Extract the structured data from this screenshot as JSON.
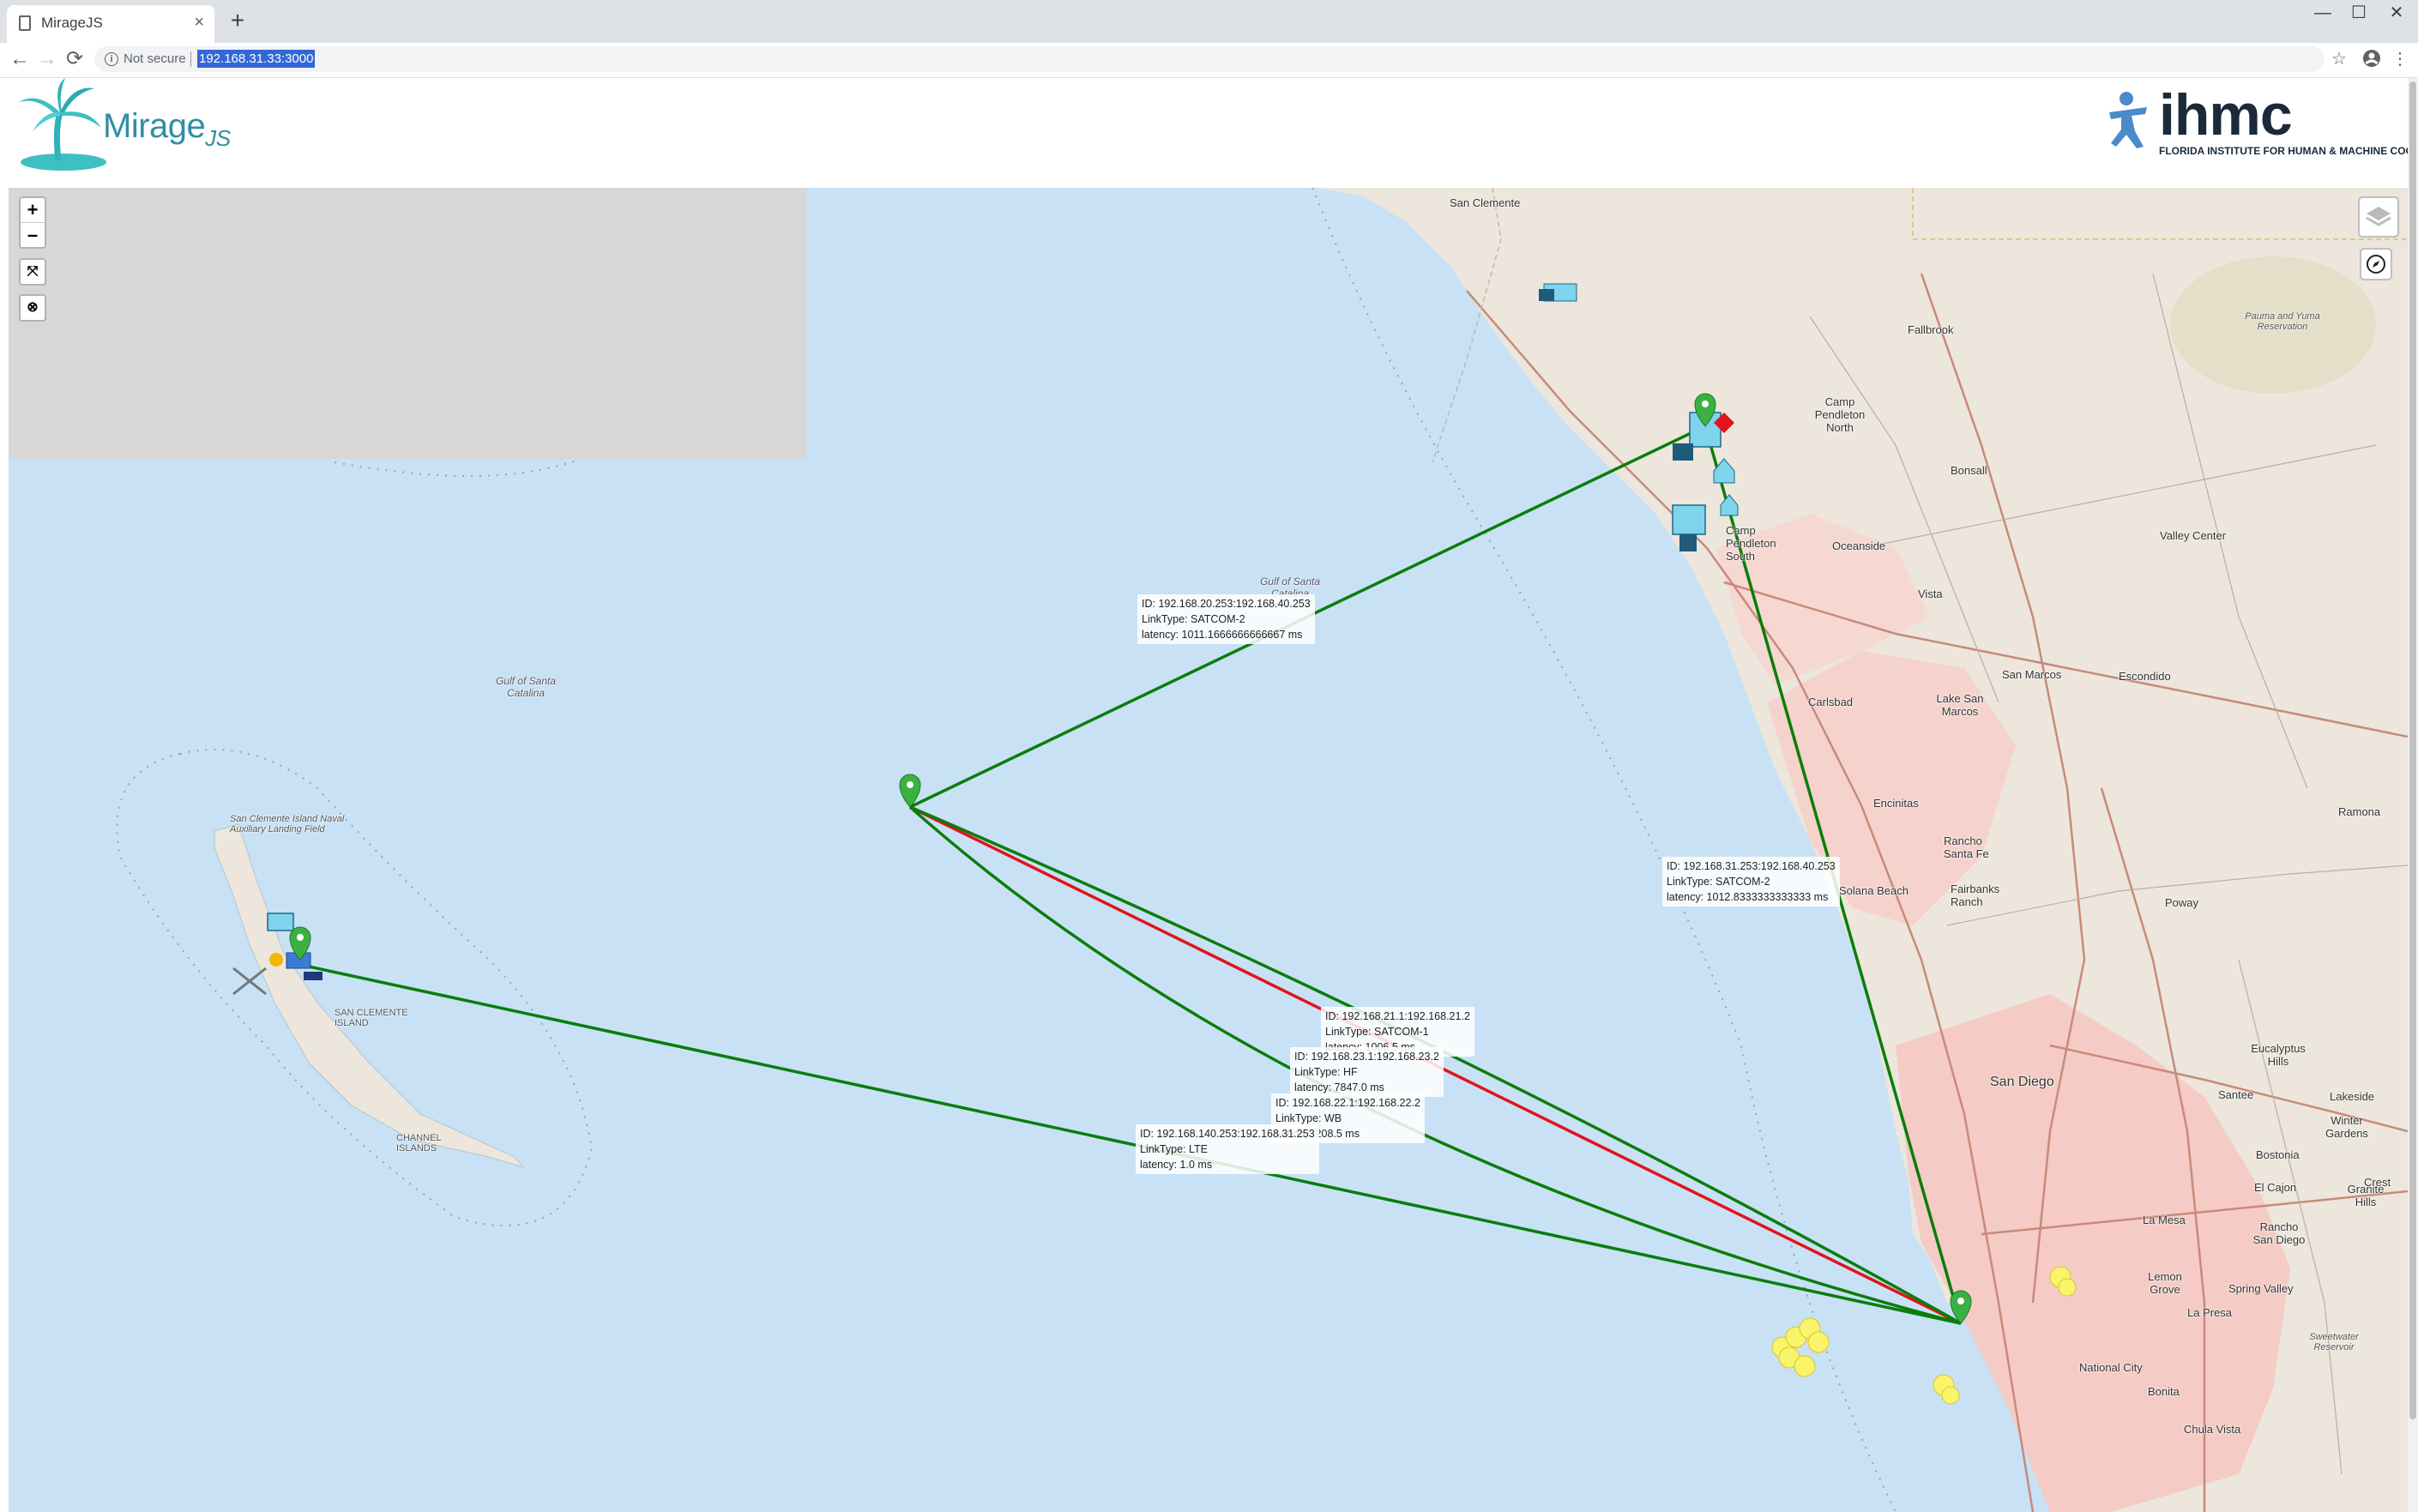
{
  "browser": {
    "tab_title": "MirageJS",
    "tab_close": "×",
    "new_tab": "+",
    "security_label": "Not secure",
    "url": "192.168.31.33:3000",
    "window_controls": {
      "minimize": "—",
      "maximize": "☐",
      "close": "✕"
    },
    "nav": {
      "back": "←",
      "forward": "→",
      "reload": "⟳"
    }
  },
  "header": {
    "app_name": "Mirage",
    "app_suffix": "JS",
    "org_name": "ihmc",
    "org_full": "FLORIDA INSTITUTE FOR HUMAN & MACHINE COGNITION"
  },
  "map_controls": {
    "zoom_in": "+",
    "zoom_out": "–",
    "fit": "⤧",
    "clear": "⊗"
  },
  "colors": {
    "link_good": "#0a7d0a",
    "link_bad": "#e0141a",
    "marker": "#3bb143",
    "water": "#c8e1f5",
    "land": "#ede7df",
    "urban": "#f4c7c3"
  },
  "places": [
    "San Clemente",
    "Fallbrook",
    "Camp Pendleton North",
    "Bonsall",
    "Valley Center",
    "Oceanside",
    "Camp Pendleton South",
    "Vista",
    "San Marcos",
    "Escondido",
    "Carlsbad",
    "Lake San Marcos",
    "Encinitas",
    "Rancho Santa Fe",
    "Solana Beach",
    "Fairbanks Ranch",
    "Poway",
    "Ramona",
    "San Diego",
    "Santee",
    "Lakeside",
    "Eucalyptus Hills",
    "Winter Gardens",
    "Bostonia",
    "El Cajon",
    "Granite Hills",
    "La Mesa",
    "Lemon Grove",
    "Rancho San Diego",
    "Spring Valley",
    "La Presa",
    "National City",
    "Bonita",
    "Chula Vista",
    "Crest",
    "Gulf of Santa Catalina",
    "Gulf of Santa Catalina",
    "San Clemente Island Naval Auxiliary Landing Field",
    "SAN CLEMENTE ISLAND",
    "CHANNEL ISLANDS",
    "Pauma and Yuma Reservation",
    "Sweetwater Reservoir"
  ],
  "links": [
    {
      "id": "ID: 192.168.20.253:192.168.40.253",
      "type": "LinkType: SATCOM-2",
      "latency": "latency: 1011.1666666666667 ms"
    },
    {
      "id": "ID: 192.168.31.253:192.168.40.253",
      "type": "LinkType: SATCOM-2",
      "latency": "latency: 1012.8333333333333 ms"
    },
    {
      "id": "ID: 192.168.21.1:192.168.21.2",
      "type": "LinkType: SATCOM-1",
      "latency": "latency: 1006.5 ms"
    },
    {
      "id": "ID: 192.168.23.1:192.168.23.2",
      "type": "LinkType: HF",
      "latency": "latency: 7847.0 ms"
    },
    {
      "id": "ID: 192.168.22.1:192.168.22.2",
      "type": "LinkType: WB",
      "latency": "latency: 208.5 ms"
    },
    {
      "id": "ID: 192.168.140.253:192.168.31.253",
      "type": "LinkType: LTE",
      "latency": "latency: 1.0 ms"
    }
  ]
}
